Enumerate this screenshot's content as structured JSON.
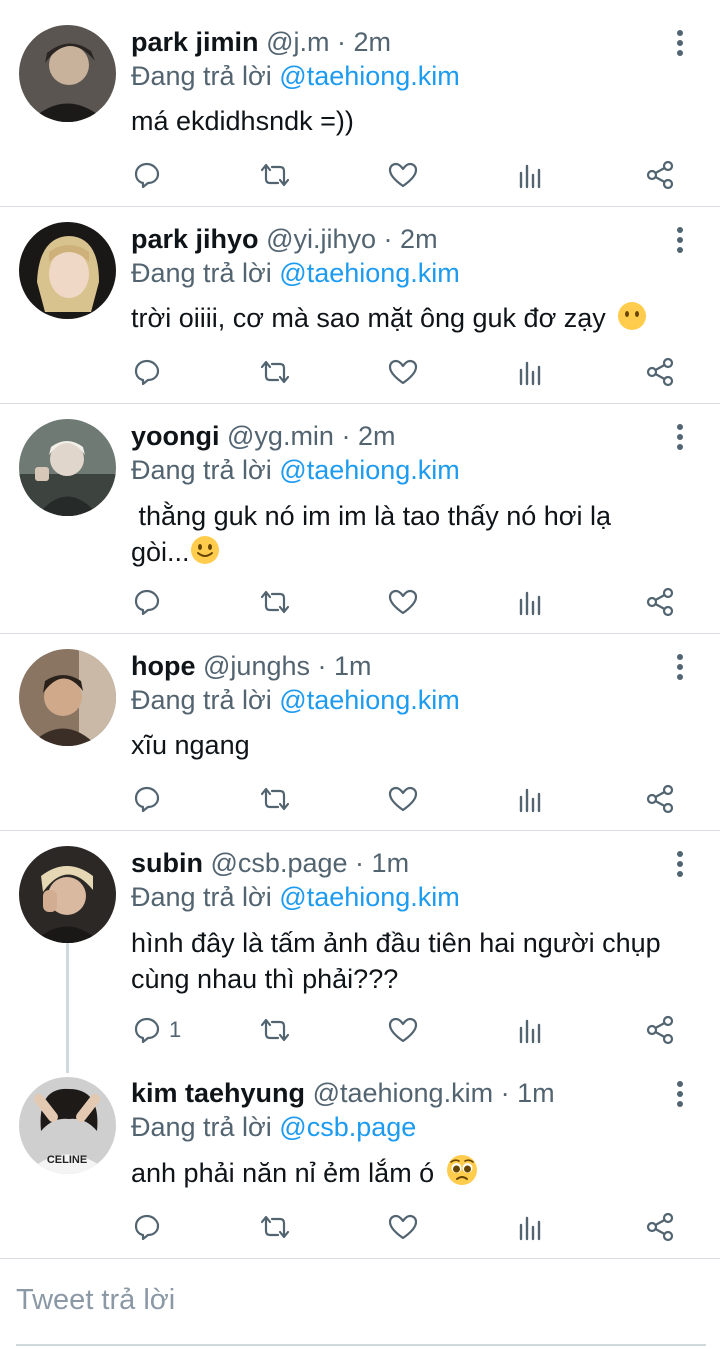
{
  "replying_prefix": "Đang trả lời",
  "tweets": [
    {
      "name": "park jimin",
      "handle": "@j.m",
      "time": "2m",
      "reply_to": "@taehiong.kim",
      "text": "má ekdidhsndk =))",
      "reply_count": ""
    },
    {
      "name": "park jihyo",
      "handle": "@yi.jihyo",
      "time": "2m",
      "reply_to": "@taehiong.kim",
      "text": "trời oiiii, cơ mà sao mặt ông guk đơ zạy",
      "emoji": "neutral-face-emoji",
      "reply_count": ""
    },
    {
      "name": "yoongi",
      "handle": "@yg.min",
      "time": "2m",
      "reply_to": "@taehiong.kim",
      "text": " thằng guk nó im im là tao thấy nó hơi lạ gòi...",
      "emoji": "smile-face-emoji",
      "reply_count": ""
    },
    {
      "name": "hope",
      "handle": "@junghs",
      "time": "1m",
      "reply_to": "@taehiong.kim",
      "text": "xĩu ngang",
      "reply_count": ""
    },
    {
      "name": "subin",
      "handle": "@csb.page",
      "time": "1m",
      "reply_to": "@taehiong.kim",
      "text": "hình đây là tấm ảnh đầu tiên hai người chụp cùng nhau thì phải???",
      "reply_count": "1"
    },
    {
      "name": "kim taehyung",
      "handle": "@taehiong.kim",
      "time": "1m",
      "reply_to": "@csb.page",
      "text": "anh phải năn nỉ ẻm lắm ó",
      "emoji": "pleading-face-emoji",
      "avatar_print": "CELINE",
      "reply_count": ""
    }
  ],
  "compose": {
    "placeholder": "Tweet trả lời"
  },
  "colors": {
    "link": "#1d9bf0",
    "muted": "#536471",
    "divider": "#d9dde1"
  }
}
